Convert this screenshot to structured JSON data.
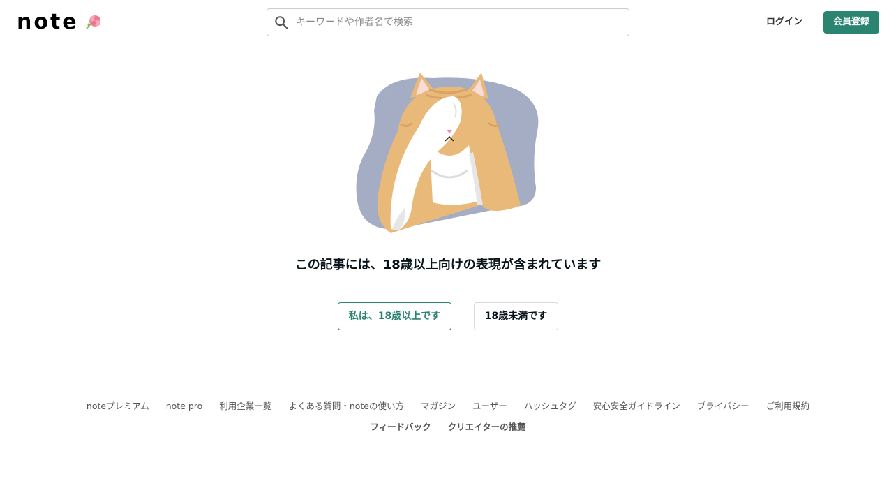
{
  "header": {
    "logo_text": "note",
    "search_placeholder": "キーワードや作者名で検索",
    "login_label": "ログイン",
    "signup_label": "会員登録"
  },
  "main": {
    "message": "この記事には、18歳以上向けの表現が含まれています",
    "adult_button": "私は、18歳以上です",
    "minor_button": "18歳未満です"
  },
  "footer": {
    "links": [
      "noteプレミアム",
      "note pro",
      "利用企業一覧",
      "よくある質問・noteの使い方",
      "マガジン",
      "ユーザー",
      "ハッシュタグ",
      "安心安全ガイドライン",
      "プライバシー",
      "ご利用規約",
      "フィードバック",
      "クリエイターの推薦"
    ]
  },
  "colors": {
    "accent": "#2b8470",
    "text": "#08131a",
    "illustration_bg": "#a5adc4",
    "cat_orange": "#e8b978"
  }
}
